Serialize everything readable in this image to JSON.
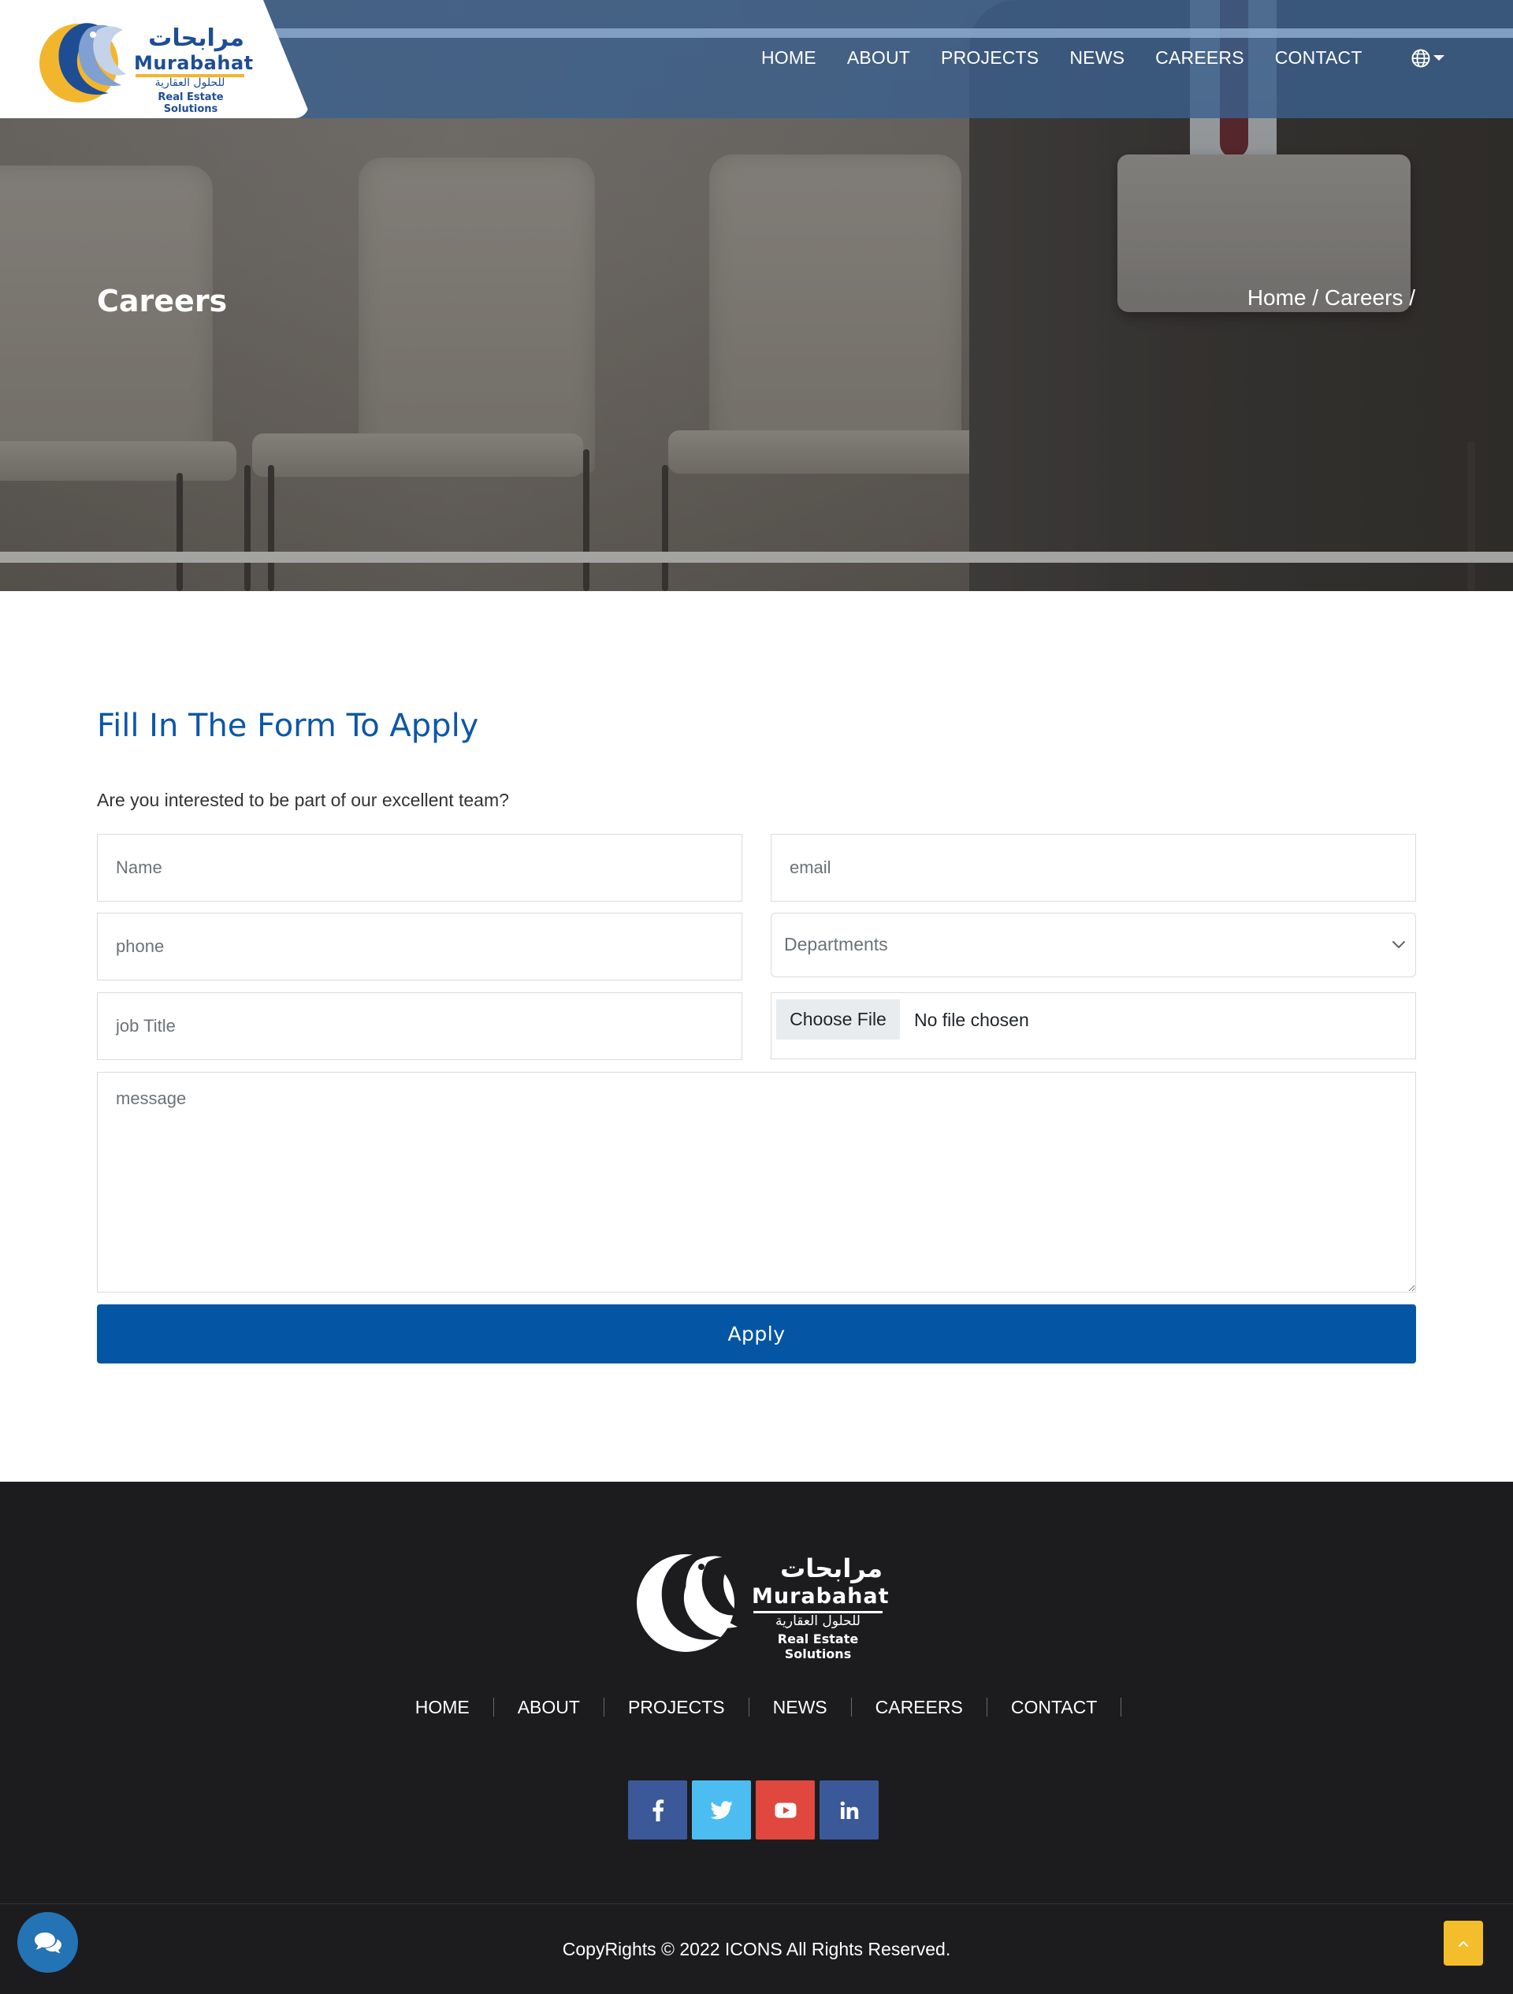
{
  "brand": {
    "name_ar": "مرابحات",
    "name_en": "Murabahat",
    "tagline_ar": "للحلول العقارية",
    "tagline_en": "Real Estate Solutions"
  },
  "nav": {
    "items": [
      "HOME",
      "ABOUT",
      "PROJECTS",
      "NEWS",
      "CAREERS",
      "CONTACT"
    ],
    "language_icon": "globe-icon"
  },
  "hero": {
    "title": "Careers",
    "breadcrumb": "Home / Careers /"
  },
  "form": {
    "heading": "Fill In The Form To Apply",
    "intro": "Are you interested to be part of our excellent team?",
    "name_placeholder": "Name",
    "email_placeholder": "email",
    "phone_placeholder": "phone",
    "departments_placeholder": "Departments",
    "job_title_placeholder": "job Title",
    "file_button": "Choose File",
    "file_status": "No file chosen",
    "message_placeholder": "message",
    "submit_label": "Apply"
  },
  "footer": {
    "nav": [
      "HOME",
      "ABOUT",
      "PROJECTS",
      "NEWS",
      "CAREERS",
      "CONTACT"
    ],
    "social": [
      {
        "name": "facebook",
        "icon": "facebook-icon",
        "color": "#3b5998"
      },
      {
        "name": "twitter",
        "icon": "twitter-icon",
        "color": "#4cbdf0"
      },
      {
        "name": "youtube",
        "icon": "youtube-icon",
        "color": "#e0473e"
      },
      {
        "name": "linkedin",
        "icon": "linkedin-icon",
        "color": "#3b5998"
      }
    ],
    "copyright": "CopyRights © 2022 ICONS All Rights Reserved."
  },
  "colors": {
    "primary": "#0455a4",
    "heading": "#0d57a7",
    "footer_bg": "#1c1c1e",
    "chat": "#2473b4",
    "scroll_top": "#f3bd2b"
  },
  "floating": {
    "chat_icon": "chat-bubbles-icon",
    "scroll_top_icon": "chevron-up-icon"
  }
}
